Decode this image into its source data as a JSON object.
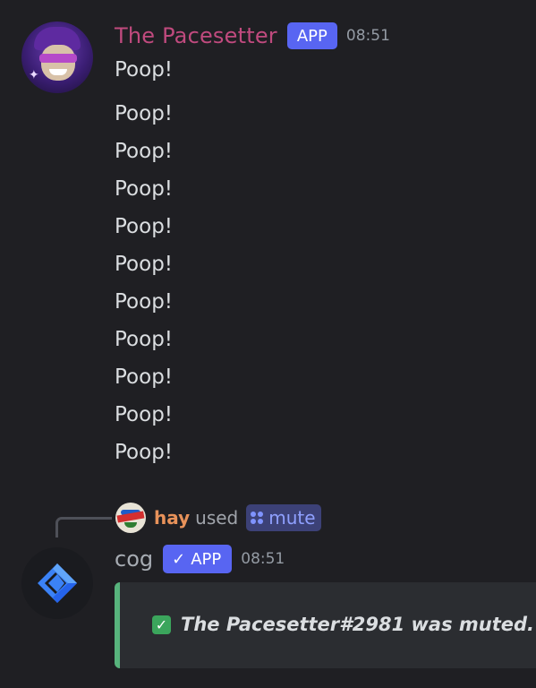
{
  "message1": {
    "username": "The Pacesetter",
    "badge": "APP",
    "timestamp": "08:51",
    "lines": [
      "Poop!",
      "Poop!",
      "Poop!",
      "Poop!",
      "Poop!",
      "Poop!",
      "Poop!",
      "Poop!",
      "Poop!",
      "Poop!",
      "Poop!"
    ],
    "username_color": "#c04a7e"
  },
  "command": {
    "user": "hay",
    "used": "used",
    "command_name": "mute",
    "user_color": "#e8925a"
  },
  "message2": {
    "username": "cog",
    "badge_check": "✓",
    "badge": "APP",
    "timestamp": "08:51",
    "embed": {
      "check": "✓",
      "text": "The Pacesetter#2981 was muted.",
      "accent_color": "#57b37c"
    }
  },
  "icons": {
    "avatar1": "pacesetter-avatar-icon",
    "small_avatar": "hay-avatar-icon",
    "cog_avatar": "cog-logo-icon",
    "command_icon": "slash-command-icon",
    "embed_check": "checkmark-icon"
  },
  "colors": {
    "background": "#1f1f23",
    "badge": "#5865f2",
    "embed_background": "#2b2d31"
  }
}
